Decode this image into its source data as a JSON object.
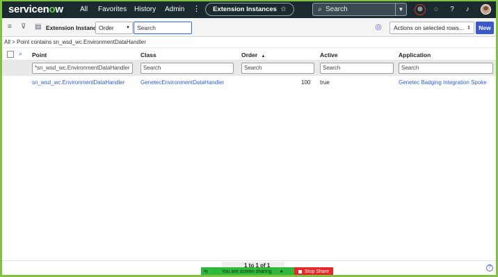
{
  "banner": {
    "logo_text": "servicenow",
    "nav": [
      "All",
      "Favorites",
      "History",
      "Admin"
    ],
    "more_icon": "vertical-dots-icon",
    "context_title": "Extension Instances",
    "favorite_icon": "star-icon",
    "search_placeholder": "Search",
    "icons": [
      "globe-icon",
      "chat-icon",
      "help-icon",
      "bell-icon",
      "avatar"
    ]
  },
  "toolbar": {
    "list_title": "Extension Instances",
    "order_select_value": "Order",
    "search_value": "Search",
    "actions_value": "Actions on selected rows...",
    "new_label": "New"
  },
  "breadcrumb": {
    "text": "All > Point contains sn_wsd_wc.EnvironmentDataHandler"
  },
  "table": {
    "columns": [
      "Point",
      "Class",
      "Order",
      "Active",
      "Application"
    ],
    "sort_indicator": "▲",
    "filters": [
      "*sn_wsd_wc.EnvironmentDataHandler",
      "Search",
      "Search",
      "Search",
      "Search"
    ],
    "rows": [
      {
        "point": "sn_wsd_wc.EnvironmentDataHandler",
        "class": "GenetecEnvironmentDataHandler",
        "order": "100",
        "active": "true",
        "application": "Genetec Badging Integration Spoke"
      }
    ]
  },
  "footer": {
    "pager_text": "1  to 1 of 1",
    "share_message": "You are screen sharing",
    "stop_share_label": "Stop Share"
  },
  "colors": {
    "banner_bg": "#1b2a2f",
    "accent_blue": "#3c59c9",
    "link": "#2a5bd7",
    "now_green": "#62d84e",
    "frame_green": "#7fc241"
  }
}
